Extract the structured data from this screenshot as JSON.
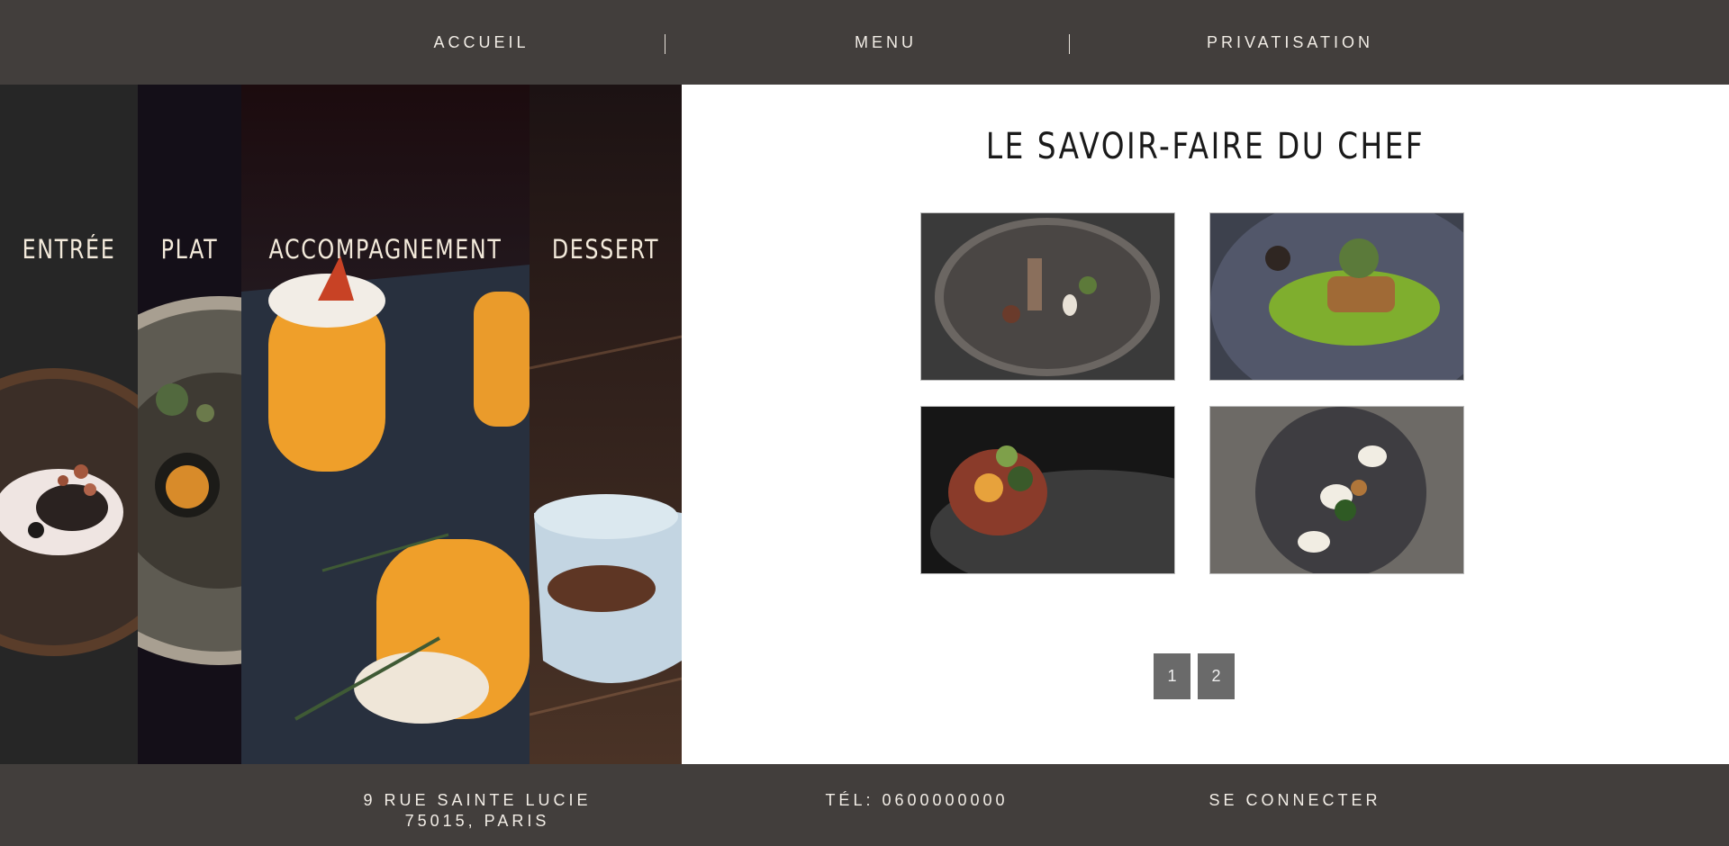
{
  "nav": {
    "items": [
      {
        "label": "ACCUEIL"
      },
      {
        "label": "MENU"
      },
      {
        "label": "PRIVATISATION"
      }
    ]
  },
  "categories": [
    {
      "label": "ENTRÉE"
    },
    {
      "label": "PLAT"
    },
    {
      "label": "ACCOMPAGNEMENT"
    },
    {
      "label": "DESSERT"
    }
  ],
  "main": {
    "title": "LE SAVOIR-FAIRE DU CHEF",
    "gallery": [
      {
        "alt": "plated-dish-1"
      },
      {
        "alt": "plated-dish-2"
      },
      {
        "alt": "plated-dish-3"
      },
      {
        "alt": "plated-dish-4"
      }
    ],
    "pagination": [
      "1",
      "2"
    ]
  },
  "footer": {
    "address_line1": "9 RUE SAINTE LUCIE",
    "address_line2": "75015, PARIS",
    "phone": "TÉL: 0600000000",
    "login": "SE CONNECTER"
  },
  "colors": {
    "header_bg": "#423e3c",
    "footer_bg": "#423e3c",
    "page_button_bg": "#6a6a6a"
  }
}
